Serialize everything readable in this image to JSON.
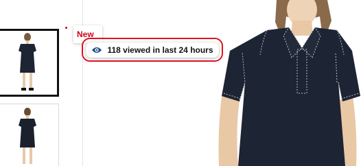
{
  "badges": {
    "new_label": "New",
    "new_color": "#d0021b"
  },
  "views": {
    "text": "118 viewed in last 24 hours",
    "icon": "eye-icon",
    "highlight_color": "#e0121f"
  },
  "gallery": {
    "thumbnails": [
      {
        "name": "thumbnail-1",
        "selected": true
      },
      {
        "name": "thumbnail-2",
        "selected": false
      }
    ]
  },
  "product": {
    "dress_color": "#1d2433",
    "stitch_color": "#b8bfc7"
  }
}
